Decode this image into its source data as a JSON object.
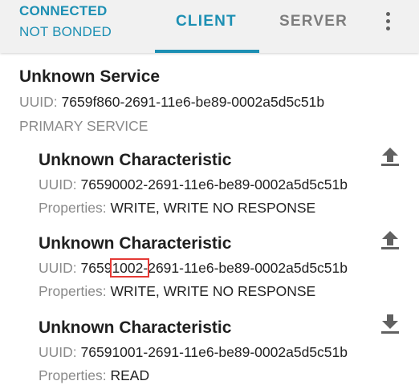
{
  "header": {
    "status_connection": "CONNECTED",
    "status_bond": "NOT BONDED",
    "tabs": [
      {
        "label": "CLIENT",
        "selected": true
      },
      {
        "label": "SERVER",
        "selected": false
      }
    ],
    "overflow_icon": "more-vert-icon"
  },
  "service": {
    "name": "Unknown Service",
    "uuid_label": "UUID:",
    "uuid": "7659f860-2691-11e6-be89-0002a5d5c51b",
    "type": "PRIMARY SERVICE"
  },
  "characteristics": [
    {
      "name": "Unknown Characteristic",
      "uuid_label": "UUID:",
      "uuid": "76590002-2691-11e6-be89-0002a5d5c51b",
      "props_label": "Properties:",
      "props": "WRITE, WRITE NO RESPONSE",
      "action_icon": "upload-icon"
    },
    {
      "name": "Unknown Characteristic",
      "uuid_label": "UUID:",
      "uuid_pre": "7659",
      "uuid_highlight": "1002-",
      "uuid_post": "2691-11e6-be89-0002a5d5c51b",
      "props_label": "Properties:",
      "props": "WRITE, WRITE NO RESPONSE",
      "action_icon": "upload-icon"
    },
    {
      "name": "Unknown Characteristic",
      "uuid_label": "UUID:",
      "uuid": "76591001-2691-11e6-be89-0002a5d5c51b",
      "props_label": "Properties:",
      "props": "READ",
      "action_icon": "download-icon"
    }
  ],
  "colors": {
    "accent": "#1c8fb3",
    "highlight_box": "#e53935"
  }
}
